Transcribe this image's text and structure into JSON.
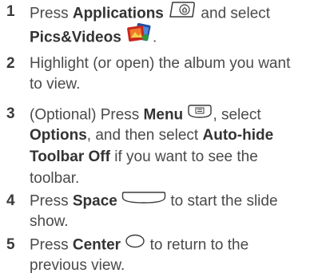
{
  "steps": [
    {
      "number": "1",
      "line1": {
        "t1": "Press ",
        "b1": "Applications",
        "t2": " and select"
      },
      "line2": {
        "b1": "Pics&Videos",
        "t1": "."
      }
    },
    {
      "number": "2",
      "line1": {
        "t1": "Highlight (or open) the album you want"
      },
      "line2": {
        "t1": "to view."
      }
    },
    {
      "number": "3",
      "line1": {
        "t1": "(Optional)  Press ",
        "b1": "Menu",
        "t2": ", select"
      },
      "line2": {
        "b1": "Options",
        "t1": ", and then select ",
        "b2": "Auto-hide"
      },
      "line3": {
        "b1": "Toolbar Off",
        "t1": " if you want to see the"
      },
      "line4": {
        "t1": "toolbar."
      }
    },
    {
      "number": "4",
      "line1": {
        "t1": "Press ",
        "b1": "Space",
        "t2": " to start the slide"
      },
      "line2": {
        "t1": "show."
      }
    },
    {
      "number": "5",
      "line1": {
        "t1": "Press ",
        "b1": "Center",
        "t2": " to return to the"
      },
      "line2": {
        "t1": "previous view."
      }
    }
  ],
  "icons": {
    "applications_key": "applications-key-icon",
    "pics_videos_app": "pics-and-videos-app-icon",
    "menu_key": "menu-key-icon",
    "space_key": "space-key-icon",
    "center_key": "center-key-icon"
  }
}
